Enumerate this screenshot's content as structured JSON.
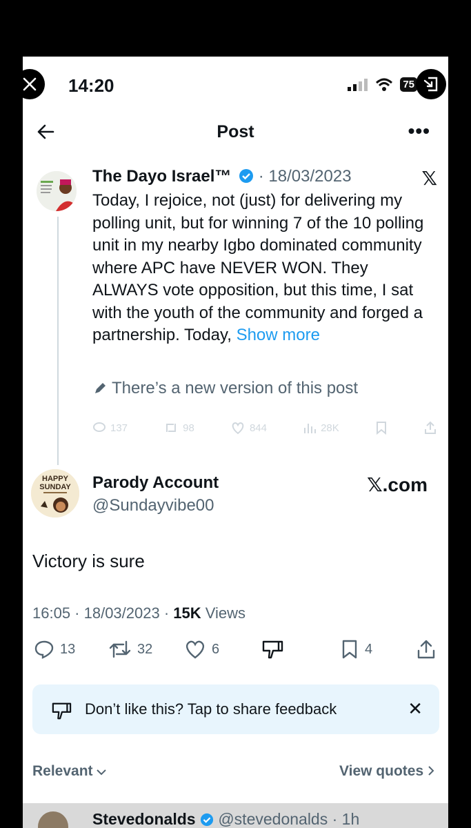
{
  "statusbar": {
    "time": "14:20",
    "battery": "75"
  },
  "nav": {
    "title": "Post"
  },
  "quoted": {
    "name": "The Dayo Israel™",
    "date": "· 18/03/2023",
    "x_logo": "𝕏",
    "text": "Today, I rejoice, not (just) for delivering my polling unit, but for winning 7 of the 10 polling unit in my nearby Igbo dominated community where APC have NEVER WON. They ALWAYS vote opposition, but this time, I sat with the youth of the community and forged a partnership. Today, ",
    "show_more": "Show more",
    "new_version": "There’s a new version of this post",
    "faded_counts": {
      "replies": "137",
      "reposts": "98",
      "likes": "844",
      "views": "28K"
    }
  },
  "post": {
    "avatar_line1": "HAPPY",
    "avatar_line2": "SUNDAY",
    "name": "Parody Account",
    "handle": "@Sundayvibe00",
    "xcom": "𝕏.com",
    "text": "Victory is sure",
    "meta_time": "16:05 · 18/03/2023 · ",
    "views_count": "15K",
    "views_label": " Views",
    "replies": "13",
    "reposts": "32",
    "likes": "6",
    "bookmarks": "4"
  },
  "feedback": {
    "text": "Don’t like this? Tap to share feedback",
    "close": "✕"
  },
  "sort": {
    "relevant": "Relevant",
    "view_quotes": "View quotes"
  },
  "reply": {
    "name": "Stevedonalds",
    "handle": "@stevedonalds · 1h"
  },
  "colors": {
    "accent": "#1d9bf0",
    "text": "#0f1419",
    "muted": "#536471",
    "feedback_bg": "#e8f5fd"
  }
}
